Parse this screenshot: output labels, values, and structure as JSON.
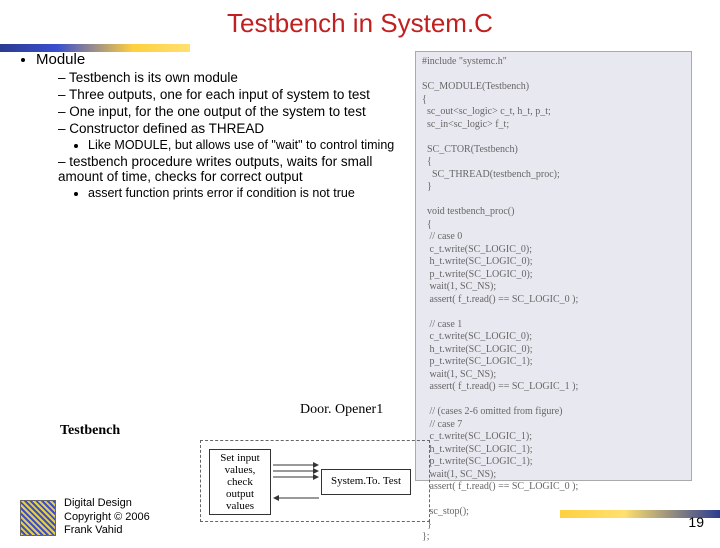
{
  "title": "Testbench in System.C",
  "bullets": {
    "top": "Module",
    "sub": [
      "Testbench is its own module",
      "Three outputs, one for each input of system to test",
      "One input, for the one output of the system to test",
      "Constructor defined as THREAD"
    ],
    "sub1_note": "Like MODULE, but allows use of \"wait\" to control timing",
    "sub2": "testbench procedure writes outputs, waits for small amount of time, checks for correct output",
    "sub2_note": "assert function prints error if condition is not true"
  },
  "labels": {
    "door": "Door. Opener1",
    "testbench": "Testbench",
    "box1": "Set input values, check output values",
    "box2": "System.To. Test"
  },
  "code": "#include \"systemc.h\"\n\nSC_MODULE(Testbench)\n{\n  sc_out<sc_logic> c_t, h_t, p_t;\n  sc_in<sc_logic> f_t;\n\n  SC_CTOR(Testbench)\n  {\n    SC_THREAD(testbench_proc);\n  }\n\n  void testbench_proc()\n  {\n   // case 0\n   c_t.write(SC_LOGIC_0);\n   h_t.write(SC_LOGIC_0);\n   p_t.write(SC_LOGIC_0);\n   wait(1, SC_NS);\n   assert( f_t.read() == SC_LOGIC_0 );\n\n   // case 1\n   c_t.write(SC_LOGIC_0);\n   h_t.write(SC_LOGIC_0);\n   p_t.write(SC_LOGIC_1);\n   wait(1, SC_NS);\n   assert( f_t.read() == SC_LOGIC_1 );\n\n   // (cases 2-6 omitted from figure)\n   // case 7\n   c_t.write(SC_LOGIC_1);\n   h_t.write(SC_LOGIC_1);\n   p_t.write(SC_LOGIC_1);\n   wait(1, SC_NS);\n   assert( f_t.read() == SC_LOGIC_0 );\n\n   sc_stop();\n  }\n};",
  "footer": {
    "l1": "Digital Design",
    "l2": "Copyright © 2006",
    "l3": "Frank Vahid"
  },
  "pagenum": "19"
}
